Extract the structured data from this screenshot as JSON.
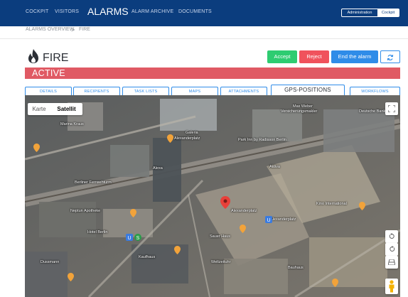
{
  "nav": {
    "items": [
      {
        "label": "COCKPIT"
      },
      {
        "label": "VISITORS"
      },
      {
        "label": "ALARMS"
      },
      {
        "label": "ALARM ARCHIVE"
      },
      {
        "label": "DOCUMENTS"
      }
    ],
    "active": "ALARMS",
    "mode_toggle": {
      "admin_label": "Administration",
      "cockpit_label": "Cockpit",
      "selected": "Cockpit"
    }
  },
  "breadcrumb": {
    "items": [
      {
        "label": "ALARMS OVERVIEW"
      },
      {
        "label": "FIRE"
      }
    ],
    "separator": ">"
  },
  "page": {
    "title": "FIRE",
    "icon": "fire-icon",
    "status": "ACTIVE"
  },
  "actions": {
    "accept_label": "Accept",
    "reject_label": "Reject",
    "end_label": "End the alarm",
    "refresh_icon": "refresh-icon"
  },
  "tabs": {
    "items": [
      {
        "label": "DETAILS"
      },
      {
        "label": "RECIPIENTS"
      },
      {
        "label": "TASK LISTS"
      },
      {
        "label": "MAPS"
      },
      {
        "label": "ATTACHMENTS"
      },
      {
        "label": "GPS-POSITIONS"
      },
      {
        "label": "WORKFLOWS"
      }
    ],
    "active": "GPS-POSITIONS"
  },
  "map": {
    "type_options": [
      {
        "label": "Karte"
      },
      {
        "label": "Satellit"
      }
    ],
    "selected_type": "Satellit",
    "labels": [
      {
        "text": "Max Weber"
      },
      {
        "text": "Versicherungsmakler"
      },
      {
        "text": "Deutsche Bank"
      },
      {
        "text": "Marina Kraus"
      },
      {
        "text": "Galeria"
      },
      {
        "text": "Alexanderplatz"
      },
      {
        "text": "Park Inn by Radisson Berlin"
      },
      {
        "text": "Aktiva"
      },
      {
        "text": "Neptun Apotheke"
      },
      {
        "text": "Alexanderplatz"
      },
      {
        "text": "Hotel Berlin"
      },
      {
        "text": "Weltzeituhr"
      },
      {
        "text": "Dussmann"
      },
      {
        "text": "Alexanderplatz"
      },
      {
        "text": "Kino International"
      },
      {
        "text": "Kaufhaus"
      },
      {
        "text": "Sauer Haus"
      },
      {
        "text": "Berliner Fernsehturm"
      },
      {
        "text": "Bauhaus"
      },
      {
        "text": "Alexa"
      }
    ],
    "controls": {
      "fullscreen_icon": "fullscreen-icon",
      "rotate_left_icon": "rotate-left-icon",
      "rotate_right_icon": "rotate-right-icon",
      "tilt_icon": "tilt-icon",
      "pegman_icon": "pegman-icon"
    },
    "colors": {
      "pin_main": "#e8403a",
      "pin_poi": "#f2a33a",
      "pin_transit": "#3a7be0"
    }
  },
  "colors": {
    "nav_bg": "#0b3d7e",
    "accept": "#2ecc71",
    "reject": "#f0525c",
    "end": "#2f8ce8",
    "status_bar": "#e05a64",
    "tab_border": "#2f8ce8"
  }
}
